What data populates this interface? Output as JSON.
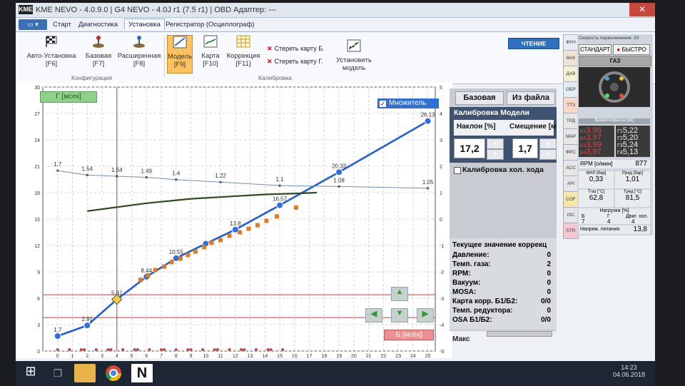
{
  "titlebar": {
    "logo": "KME",
    "title": "KME NEVO - 4.0.9.0  |  G4 NEVO - 4.0J r1 (7.5 r1)  |  OBD Адаптер: ---",
    "close": "✕"
  },
  "tabs": {
    "menu": "▭ ▾",
    "items": [
      "Старт",
      "Диагностика",
      "Установка",
      "Регистратор (Осциллограф)"
    ],
    "active": 2
  },
  "ribbon": {
    "config_buttons": [
      {
        "label": "Авто-Установка",
        "key": "[F6]"
      },
      {
        "label": "Базовая",
        "key": "[F7]"
      },
      {
        "label": "Расширенная",
        "key": "[F8]"
      }
    ],
    "config_group": "Конфигурация",
    "calib_buttons": [
      {
        "label": "Модель",
        "key": "[F9]"
      },
      {
        "label": "Карта",
        "key": "[F10]"
      },
      {
        "label": "Коррекция",
        "key": "[F11]"
      }
    ],
    "calib_group": "Калибровка",
    "erase_b": "Стереть карту Б.",
    "erase_g": "Стереть карту Г.",
    "fit_model": "Установить модель"
  },
  "chart_data": {
    "type": "line",
    "title": "",
    "ylabel": "Г [мсек]",
    "xlabel": "Б [мсек]",
    "ylim": [
      0,
      30
    ],
    "xlim": [
      -1,
      25.5
    ],
    "y2lim": [
      -5,
      5
    ],
    "yticks": [
      0,
      3,
      6,
      9,
      12,
      15,
      18,
      21,
      24,
      27,
      30
    ],
    "y2ticks": [
      -5,
      -4,
      -3,
      -2,
      -1,
      0,
      1,
      2,
      3,
      4,
      5
    ],
    "xticks": [
      0,
      1,
      2,
      3,
      4,
      5,
      6,
      7,
      8,
      9,
      10,
      11,
      12,
      13,
      14,
      15,
      16,
      17,
      18,
      19,
      20,
      21,
      22,
      23,
      24,
      25
    ],
    "checkbox_label": "Множитель",
    "series": [
      {
        "name": "",
        "role": "model",
        "color": "#1f5fd6",
        "x": [
          0,
          2,
          4,
          6,
          8,
          10,
          12,
          15,
          19,
          25
        ],
        "y": [
          1.7,
          2.91,
          5.87,
          8.44,
          10.55,
          12.2,
          13.8,
          16.57,
          20.33,
          26.13
        ],
        "labels": [
          "1.7",
          "2.91",
          "5.87",
          "8.44",
          "10.55",
          "",
          "13.8",
          "16.57",
          "20.33",
          "26.13"
        ]
      },
      {
        "name": "",
        "role": "multiplier",
        "color": "#6e8fb0",
        "x": [
          0,
          2,
          4,
          6,
          8,
          11,
          15,
          19,
          25
        ],
        "y": [
          20.5,
          20.0,
          19.86,
          19.74,
          19.48,
          19.2,
          18.8,
          18.7,
          18.5
        ],
        "labels": [
          "1.7",
          "1.54",
          "1.54",
          "1.49",
          "1.4",
          "1.22",
          "1.1",
          "1.08",
          "1.05"
        ]
      },
      {
        "name": "",
        "role": "correction",
        "color": "#2e4a1e",
        "x": [
          2,
          6,
          9,
          12,
          14,
          16,
          17.5
        ],
        "y": [
          15.9,
          16.8,
          17.3,
          17.6,
          17.8,
          17.9,
          18.0
        ]
      },
      {
        "name": "",
        "role": "points",
        "color": "#e07b22",
        "x": [
          5.6,
          6.1,
          6.6,
          7.2,
          7.7,
          8.3,
          8.8,
          9.3,
          9.9,
          10.4,
          11,
          11.6,
          12.3,
          12.9,
          13.5,
          14.1,
          14.8,
          16.1
        ],
        "y": [
          8.1,
          8.6,
          9.2,
          9.6,
          10.1,
          10.5,
          10.9,
          11.3,
          11.8,
          12.3,
          12.6,
          13.1,
          13.5,
          13.9,
          14.3,
          14.8,
          15.3,
          16.3
        ]
      }
    ],
    "guides": {
      "red_vertical_x": 4,
      "red_horizontal_y": 6.4,
      "red_horizontal_y2": 3.8
    }
  },
  "calib": {
    "btn_base": "Базовая",
    "btn_file": "Из файла",
    "title": "Калибровка Модели",
    "slope_label": "Наклон [%]",
    "offset_label": "Смещение [м",
    "slope_value": "17,2",
    "offset_value": "1,7",
    "idle_label": "Калибровка хол. хода"
  },
  "current": {
    "title": "Текущее значение коррекц",
    "rows": [
      {
        "label": "Давление:",
        "value": "0"
      },
      {
        "label": "Темп. газа:",
        "value": "2"
      },
      {
        "label": "RPM:",
        "value": "0"
      },
      {
        "label": "Вакуум:",
        "value": "0"
      },
      {
        "label": "MOSA:",
        "value": "0"
      },
      {
        "label": "Карта корр. Б1/Б2:",
        "value": "0/0"
      },
      {
        "label": "Темп. редуктора:",
        "value": "0"
      },
      {
        "label": "OSA Б1/Б2:",
        "value": "0/0"
      }
    ],
    "max_label": "Макс"
  },
  "b_msec_label": "Б [мсек]",
  "status": {
    "reading": "ЧТЕНИЕ"
  },
  "side_tabs": [
    "ФУН",
    "ВАК",
    "ДАВ",
    "ОБР",
    "ТТЗ",
    "ТРД",
    "МАР",
    "ФРС",
    "АСС",
    "АРІ",
    "COF",
    "ISC",
    "STR",
    "MOSA"
  ],
  "panel": {
    "header": "Скорость переключения: 20",
    "standard": "СТАНДАРТ",
    "fast": "БЫСТРО",
    "gas": "ГАЗ",
    "injection_header": "Время впрыска [мс]",
    "petrol": [
      {
        "k": "Б1",
        "v": "3,98"
      },
      {
        "k": "Б2",
        "v": "3,97"
      },
      {
        "k": "Б3",
        "v": "3,99"
      },
      {
        "k": "Б4",
        "v": "3,97"
      }
    ],
    "gas_vals": [
      {
        "k": "Г1",
        "v": "5,22"
      },
      {
        "k": "Г2",
        "v": "5,20"
      },
      {
        "k": "Г3",
        "v": "5,24"
      },
      {
        "k": "Г4",
        "v": "5,13"
      }
    ],
    "rpm_label": "RPM [о/мин]",
    "rpm": "877",
    "map_label": "MAP [бар]",
    "map": "0,33",
    "pred_label": "Pред [бар]",
    "pred": "1,01",
    "tgas_label": "Tгаз [°C]",
    "tgas": "62,8",
    "tred_label": "Tред [°C]",
    "tred": "81,5",
    "load_label": "Нагрузка [%]",
    "load_cols": [
      "Б",
      "Г",
      "Двиг. хол."
    ],
    "load_vals": [
      "7",
      "4",
      "4"
    ],
    "voltage_label": "Напряж. питания",
    "voltage": "13,8"
  },
  "taskbar": {
    "time": "14:23",
    "date": "04.06.2018"
  }
}
